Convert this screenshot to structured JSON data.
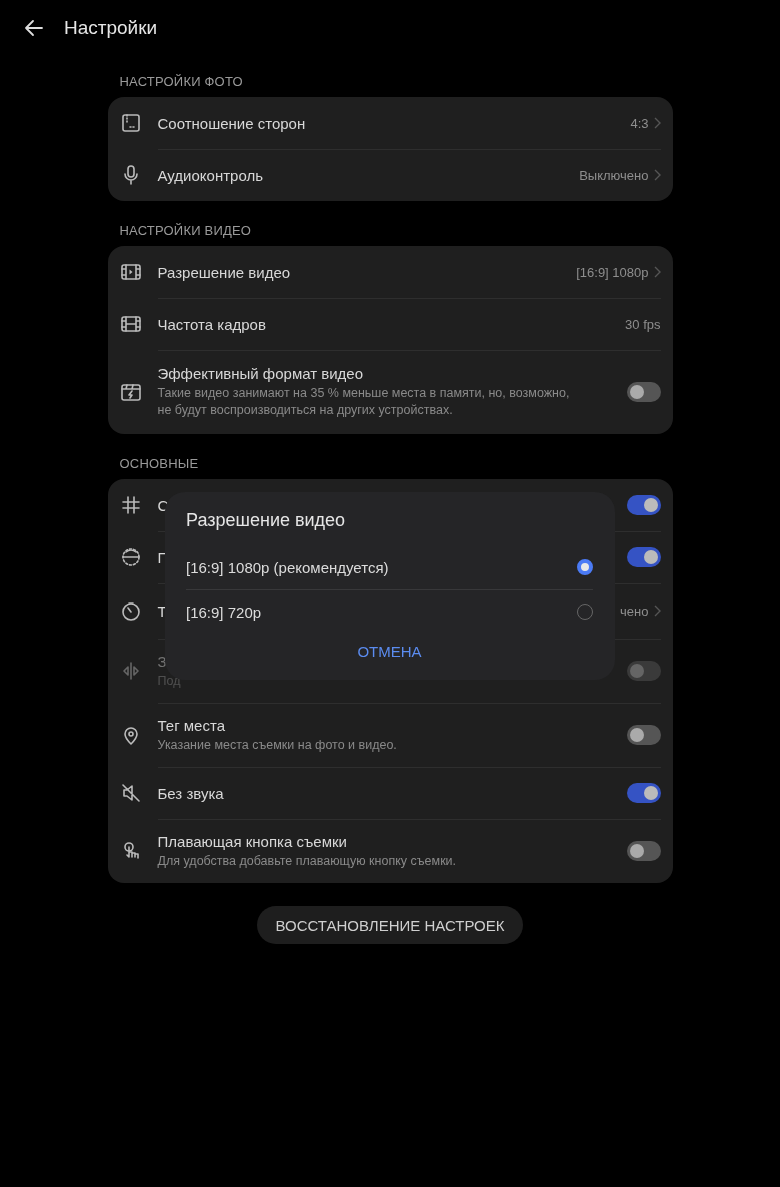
{
  "header": {
    "title": "Настройки"
  },
  "sections": [
    {
      "label": "НАСТРОЙКИ ФОТО",
      "items": [
        {
          "kind": "nav",
          "title": "Соотношение сторон",
          "value": "4:3"
        },
        {
          "kind": "nav",
          "title": "Аудиоконтроль",
          "value": "Выключено"
        }
      ]
    },
    {
      "label": "НАСТРОЙКИ ВИДЕО",
      "items": [
        {
          "kind": "nav",
          "title": "Разрешение видео",
          "value": "[16:9] 1080p"
        },
        {
          "kind": "value",
          "title": "Частота кадров",
          "value": "30 fps"
        },
        {
          "kind": "toggle",
          "title": "Эффективный формат видео",
          "subtitle": "Такие видео занимают на 35 % меньше места в памяти, но, возможно, не будут воспроизводиться на других устройствах.",
          "on": false,
          "disabled": false
        }
      ]
    },
    {
      "label": "ОСНОВНЫЕ",
      "items": [
        {
          "kind": "toggle",
          "title": "С",
          "on": true,
          "disabled": false
        },
        {
          "kind": "toggle",
          "title": "Г",
          "on": true,
          "disabled": false
        },
        {
          "kind": "nav",
          "title": "Т",
          "value": "чено"
        },
        {
          "kind": "toggle",
          "title": "З",
          "subtitle": "Под",
          "on": false,
          "disabled": true
        },
        {
          "kind": "toggle",
          "title": "Тег места",
          "subtitle": "Указание места съемки на фото и видео.",
          "on": false,
          "disabled": false
        },
        {
          "kind": "toggle",
          "title": "Без звука",
          "on": true,
          "disabled": false
        },
        {
          "kind": "toggle",
          "title": "Плавающая кнопка съемки",
          "subtitle": "Для удобства добавьте плавающую кнопку съемки.",
          "on": false,
          "disabled": false
        }
      ]
    }
  ],
  "reset_button": "ВОССТАНОВЛЕНИЕ НАСТРОЕК",
  "dialog": {
    "title": "Разрешение видео",
    "options": [
      {
        "label": "[16:9] 1080p (рекомендуется)",
        "selected": true
      },
      {
        "label": "[16:9] 720p",
        "selected": false
      }
    ],
    "cancel": "ОТМЕНА"
  }
}
